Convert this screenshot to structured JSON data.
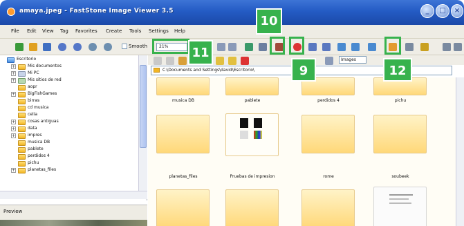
{
  "window": {
    "title": "amaya.jpeg - FastStone Image Viewer 3.5",
    "buttons": [
      "_",
      "□",
      "×"
    ]
  },
  "menu": [
    "File",
    "Edit",
    "View",
    "Tag",
    "Favorites",
    "Create",
    "Tools",
    "Settings",
    "Help"
  ],
  "toolbar": {
    "smooth_label": "Smooth",
    "zoom_value": "21%"
  },
  "tree": [
    {
      "label": "Escritorio",
      "level": 0,
      "exp": ""
    },
    {
      "label": "Mis documentos",
      "level": 1,
      "exp": "+"
    },
    {
      "label": "Mi PC",
      "level": 1,
      "exp": "+"
    },
    {
      "label": "Mis sitios de red",
      "level": 1,
      "exp": "+"
    },
    {
      "label": "aopr",
      "level": 1,
      "exp": ""
    },
    {
      "label": "BigFishGames",
      "level": 1,
      "exp": "+"
    },
    {
      "label": "birras",
      "level": 1,
      "exp": ""
    },
    {
      "label": "cd musica",
      "level": 1,
      "exp": ""
    },
    {
      "label": "celia",
      "level": 1,
      "exp": ""
    },
    {
      "label": "cosas antiguas",
      "level": 1,
      "exp": "+"
    },
    {
      "label": "data",
      "level": 1,
      "exp": "+"
    },
    {
      "label": "impres",
      "level": 1,
      "exp": "+"
    },
    {
      "label": "musica DB",
      "level": 1,
      "exp": ""
    },
    {
      "label": "pablete",
      "level": 1,
      "exp": ""
    },
    {
      "label": "perdidos 4",
      "level": 1,
      "exp": ""
    },
    {
      "label": "pichu",
      "level": 1,
      "exp": ""
    },
    {
      "label": "planetas_files",
      "level": 1,
      "exp": "+"
    }
  ],
  "preview_label": "Preview",
  "path": "C:\\Documents and Settings\\david\\Escritorio\\",
  "view_filter": "Images",
  "thumbnails_row1": [
    "musica DB",
    "pablete",
    "perdidos 4",
    "pichu"
  ],
  "thumbnails_row2": [
    "planetas_files",
    "Pruebas de impresion",
    "rome",
    "soubeek"
  ],
  "badges": [
    "10",
    "11",
    "9",
    "12"
  ],
  "colors": {
    "badge": "#37b24d",
    "titlebar": "#245bc4"
  }
}
